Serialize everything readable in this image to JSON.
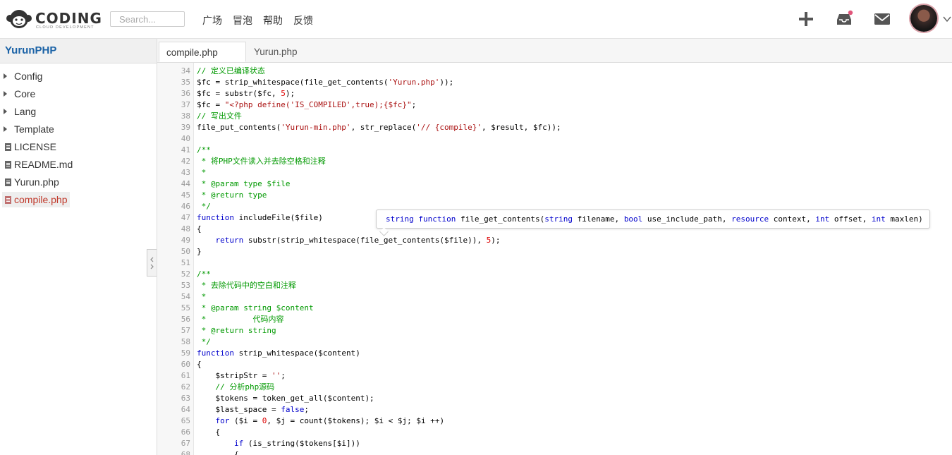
{
  "header": {
    "logo_text": "CODING",
    "logo_sub": "CLOUD DEVELOPMENT",
    "search_placeholder": "Search...",
    "nav": [
      "广场",
      "冒泡",
      "帮助",
      "反馈"
    ],
    "icons": [
      "plus-icon",
      "inbox-icon",
      "mail-icon",
      "avatar",
      "chevron-down-icon"
    ],
    "notification_dot_color": "#e0557a"
  },
  "sidebar": {
    "project": "YurunPHP",
    "items": [
      {
        "type": "folder",
        "label": "Config"
      },
      {
        "type": "folder",
        "label": "Core"
      },
      {
        "type": "folder",
        "label": "Lang"
      },
      {
        "type": "folder",
        "label": "Template"
      },
      {
        "type": "file",
        "label": "LICENSE"
      },
      {
        "type": "file",
        "label": "README.md"
      },
      {
        "type": "file",
        "label": "Yurun.php"
      },
      {
        "type": "file",
        "label": "compile.php",
        "active": true
      }
    ]
  },
  "tabs": [
    {
      "label": "compile.php",
      "active": true
    },
    {
      "label": "Yurun.php",
      "active": false
    }
  ],
  "editor": {
    "lines": [
      {
        "n": "34",
        "t": "// 定义已编译状态"
      },
      {
        "n": "35",
        "t": "$fc = strip_whitespace(file_get_contents('Yurun.php'));"
      },
      {
        "n": "36",
        "t": "$fc = substr($fc, 5);"
      },
      {
        "n": "37",
        "t": "$fc = \"<?php define('IS_COMPILED',true);{$fc}\";"
      },
      {
        "n": "38",
        "t": "// 写出文件"
      },
      {
        "n": "39",
        "t": "file_put_contents('Yurun-min.php', str_replace('// {compile}', $result, $fc));"
      },
      {
        "n": "40",
        "t": ""
      },
      {
        "n": "41",
        "t": "/**"
      },
      {
        "n": "42",
        "t": " * 将PHP文件读入并去除空格和注释"
      },
      {
        "n": "43",
        "t": " *"
      },
      {
        "n": "44",
        "t": " * @param type $file"
      },
      {
        "n": "45",
        "t": " * @return type"
      },
      {
        "n": "46",
        "t": " */"
      },
      {
        "n": "47",
        "t": "function includeFile($file)"
      },
      {
        "n": "48",
        "t": "{"
      },
      {
        "n": "49",
        "t": "    return substr(strip_whitespace(file_get_contents($file)), 5);"
      },
      {
        "n": "50",
        "t": "}"
      },
      {
        "n": "51",
        "t": ""
      },
      {
        "n": "52",
        "t": "/**"
      },
      {
        "n": "53",
        "t": " * 去除代码中的空白和注释"
      },
      {
        "n": "54",
        "t": " *"
      },
      {
        "n": "55",
        "t": " * @param string $content"
      },
      {
        "n": "56",
        "t": " *          代码内容"
      },
      {
        "n": "57",
        "t": " * @return string"
      },
      {
        "n": "58",
        "t": " */"
      },
      {
        "n": "59",
        "t": "function strip_whitespace($content)"
      },
      {
        "n": "60",
        "t": "{"
      },
      {
        "n": "61",
        "t": "    $stripStr = '';"
      },
      {
        "n": "62",
        "t": "    // 分析php源码"
      },
      {
        "n": "63",
        "t": "    $tokens = token_get_all($content);"
      },
      {
        "n": "64",
        "t": "    $last_space = false;"
      },
      {
        "n": "65",
        "t": "    for ($i = 0, $j = count($tokens); $i < $j; $i ++)"
      },
      {
        "n": "66",
        "t": "    {"
      },
      {
        "n": "67",
        "t": "        if (is_string($tokens[$i]))"
      },
      {
        "n": "68",
        "t": "        {"
      }
    ],
    "tooltip": "string function file_get_contents(string filename, bool use_include_path, resource context, int offset, int maxlen)"
  }
}
